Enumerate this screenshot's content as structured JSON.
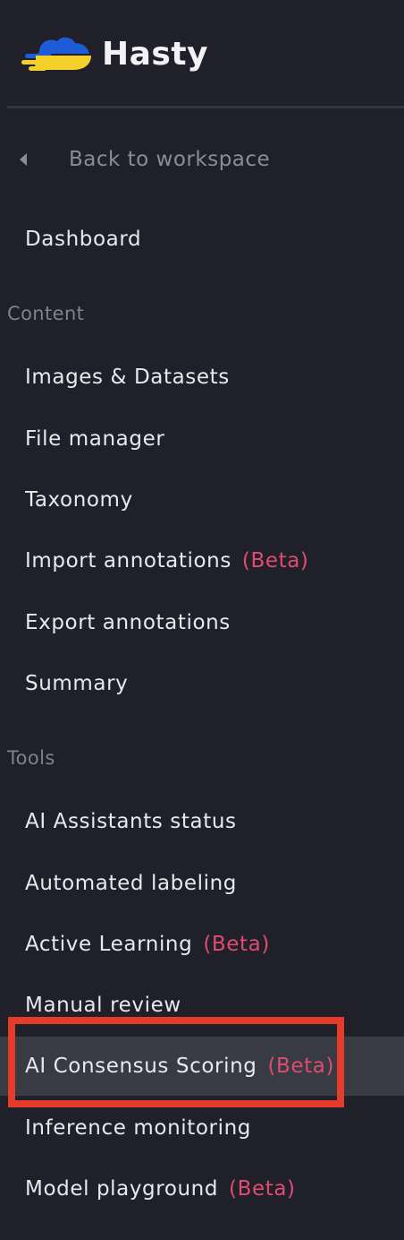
{
  "brand": {
    "name": "Hasty",
    "logo_colors": {
      "top": "#1e5bd6",
      "bottom": "#f5cf2a"
    }
  },
  "back_link": {
    "label": "Back to workspace"
  },
  "nav": {
    "dashboard": "Dashboard",
    "sections": [
      {
        "title": "Content",
        "items": [
          {
            "label": "Images & Datasets",
            "badge": ""
          },
          {
            "label": "File manager",
            "badge": ""
          },
          {
            "label": "Taxonomy",
            "badge": ""
          },
          {
            "label": "Import annotations",
            "badge": "(Beta)"
          },
          {
            "label": "Export annotations",
            "badge": ""
          },
          {
            "label": "Summary",
            "badge": ""
          }
        ]
      },
      {
        "title": "Tools",
        "items": [
          {
            "label": "AI Assistants status",
            "badge": ""
          },
          {
            "label": "Automated labeling",
            "badge": ""
          },
          {
            "label": "Active Learning",
            "badge": "(Beta)"
          },
          {
            "label": "Manual review",
            "badge": ""
          },
          {
            "label": "AI Consensus Scoring",
            "badge": "(Beta)",
            "active": true
          },
          {
            "label": "Inference monitoring",
            "badge": ""
          },
          {
            "label": "Model playground",
            "badge": "(Beta)"
          }
        ]
      }
    ]
  },
  "colors": {
    "background": "#1f2029",
    "active_item": "#383a44",
    "beta": "#e04c6f",
    "highlight": "#e63a2a"
  }
}
